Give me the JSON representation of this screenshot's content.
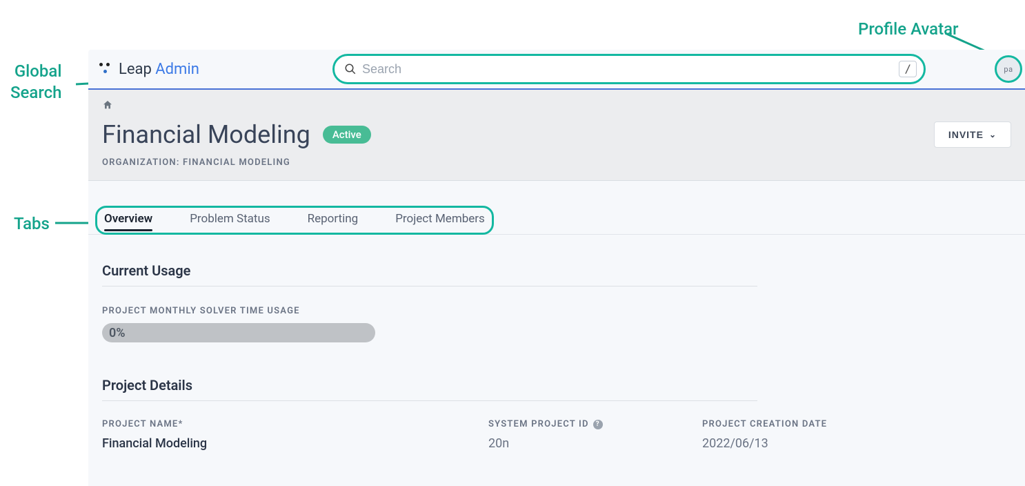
{
  "annotations": {
    "global_search_line1": "Global",
    "global_search_line2": "Search",
    "tabs_label": "Tabs",
    "profile_avatar_label": "Profile Avatar"
  },
  "header": {
    "brand_leap": "Leap ",
    "brand_admin": "Admin",
    "search_placeholder": "Search",
    "search_shortcut": "/",
    "avatar_initials": "pa"
  },
  "page": {
    "title": "Financial Modeling",
    "status_badge": "Active",
    "invite_label": "INVITE",
    "organization_label": "ORGANIZATION: FINANCIAL MODELING"
  },
  "tabs": [
    {
      "label": "Overview",
      "active": true
    },
    {
      "label": "Problem Status",
      "active": false
    },
    {
      "label": "Reporting",
      "active": false
    },
    {
      "label": "Project Members",
      "active": false
    }
  ],
  "usage": {
    "section_title": "Current Usage",
    "metric_label": "PROJECT MONTHLY SOLVER TIME USAGE",
    "percent_text": "0%"
  },
  "details": {
    "section_title": "Project Details",
    "project_name_label": "PROJECT NAME*",
    "project_name_value": "Financial Modeling",
    "system_id_label": "SYSTEM PROJECT ID",
    "system_id_value": "20n",
    "creation_date_label": "PROJECT CREATION DATE",
    "creation_date_value": "2022/06/13"
  }
}
